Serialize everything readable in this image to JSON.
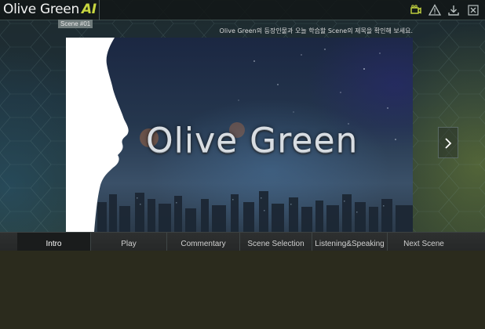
{
  "app": {
    "logo_text": "Olive Green",
    "logo_suffix": "AI"
  },
  "toolbar": {
    "icons": [
      "video-camera-icon",
      "warning-icon",
      "download-icon",
      "close-icon"
    ]
  },
  "scene": {
    "badge": "Scene #01",
    "instruction": "Olive Green의 등장인물과 오늘 학습할 Scene의 제목을 확인해 보세요."
  },
  "video": {
    "title": "Olive Green"
  },
  "nav": {
    "items": [
      {
        "label": "Intro",
        "active": true
      },
      {
        "label": "Play",
        "active": false
      },
      {
        "label": "Commentary",
        "active": false
      },
      {
        "label": "Scene Selection",
        "active": false
      },
      {
        "label": "Listening&Speaking",
        "active": false
      },
      {
        "label": "Next Scene",
        "active": false
      }
    ]
  },
  "colors": {
    "accent": "#c7d640",
    "nav_active": "#1a1c1c",
    "background_lower": "#2b2b1d"
  }
}
